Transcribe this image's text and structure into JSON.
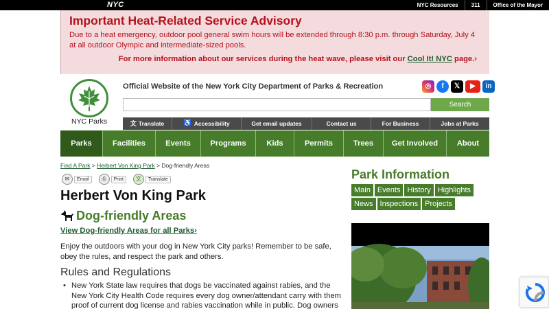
{
  "nyc_bar": {
    "logo": "NYC",
    "links": [
      "NYC Resources",
      "311",
      "Office of the Mayor"
    ]
  },
  "advisory": {
    "title": "Important Heat-Related Service Advisory",
    "text": "Due to a heat emergency, outdoor pool general swim hours will be extended through 8:30 p.m. through Saturday, July 4 at all outdoor Olympic and intermediate-sized pools.",
    "more_prefix": "For more information about our services during the heat wave, please visit our",
    "more_link": "Cool It! NYC",
    "more_suffix": "page.",
    "chevron": "›"
  },
  "header": {
    "logo_text": "NYC Parks",
    "site_title": "Official Website of the New York City Department of Parks & Recreation",
    "social": [
      "instagram-icon",
      "facebook-icon",
      "x-icon",
      "youtube-icon",
      "linkedin-icon"
    ],
    "search_button": "Search",
    "search_value": ""
  },
  "util_links": [
    "Translate",
    "Accessibility",
    "Get email updates",
    "Contact us",
    "For Business",
    "Jobs at Parks"
  ],
  "main_nav": [
    "Parks",
    "Facilities",
    "Events",
    "Programs",
    "Kids",
    "Permits",
    "Trees",
    "Get Involved",
    "About"
  ],
  "breadcrumb": {
    "item1": "Find A Park",
    "sep1": " > ",
    "item2": "Herbert Von King Park",
    "sep2": " > ",
    "current": "Dog-friendly Areas"
  },
  "tools": [
    "Email",
    "Print",
    "Translate"
  ],
  "content": {
    "park_title": "Herbert Von King Park",
    "section_title": "Dog-friendly Areas",
    "view_all": "View Dog-friendly Areas for all Parks",
    "view_all_chevron": "›",
    "intro": "Enjoy the outdoors with your dog in New York City parks! Remember to be safe, obey the rules, and respect the park and others.",
    "rules_heading": "Rules and Regulations",
    "rule1": "New York State law requires that dogs be vaccinated against rabies, and the New York City Health Code requires every dog owner/attendant carry with them proof of current dog license and rabies vaccination while in public. Dog owners may be fined"
  },
  "sidebar": {
    "title": "Park Information",
    "tabs_row1": [
      "Main",
      "Events",
      "History",
      "Highlights"
    ],
    "tabs_row2": [
      "News",
      "Inspections",
      "Projects"
    ]
  },
  "colors": {
    "green": "#467c2a",
    "advisory_red": "#b5121b",
    "advisory_bg": "#f3dbde"
  }
}
